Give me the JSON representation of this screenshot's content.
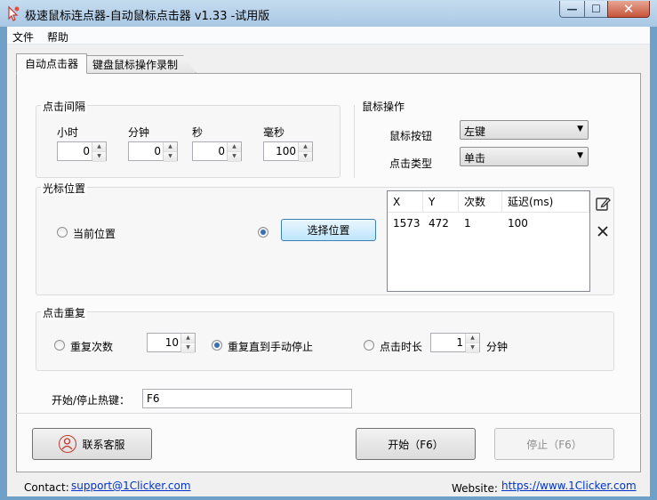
{
  "window": {
    "title": "极速鼠标连点器-自动鼠标点击器 v1.33  -试用版",
    "min": "—",
    "max": "☐",
    "close": "✕"
  },
  "menu": [
    "文件",
    "帮助"
  ],
  "tabs": [
    "自动点击器",
    "键盘鼠标操作录制"
  ],
  "interval": {
    "group_label": "点击间隔",
    "hours": {
      "label": "小时",
      "value": "0"
    },
    "minutes": {
      "label": "分钟",
      "value": "0"
    },
    "seconds": {
      "label": "秒",
      "value": "0"
    },
    "ms": {
      "label": "毫秒",
      "value": "100"
    }
  },
  "mouse": {
    "group_label": "鼠标操作",
    "button_label": "鼠标按钮",
    "button_value": "左键",
    "click_type_label": "点击类型",
    "click_type_value": "单击"
  },
  "cursor": {
    "group_label": "光标位置",
    "current_position_label": "当前位置",
    "current_position_selected": false,
    "pick_position_selected": true,
    "pick_button": "选择位置",
    "table_headers": [
      "X",
      "Y",
      "次数",
      "延迟(ms)"
    ],
    "rows": [
      {
        "x": "1573",
        "y": "472",
        "count": "1",
        "delay": "100"
      }
    ]
  },
  "repeat": {
    "group_label": "点击重复",
    "repeat_count_label": "重复次数",
    "repeat_count_value": "10",
    "until_stop_label": "重复直到手动停止",
    "duration_label": "点击时长",
    "duration_value": "1",
    "duration_unit": "分钟",
    "selected": "until_stop"
  },
  "hotkey": {
    "label": "开始/停止热键：",
    "value": "F6"
  },
  "buttons": {
    "contact": "联系客服",
    "start": "开始（F6）",
    "stop": "停止（F6）"
  },
  "footer": {
    "contact_label": "Contact:",
    "contact_email": "support@1Clicker.com",
    "website_label": "Website:",
    "website_url": "https://www.1Clicker.com"
  },
  "colors": {
    "titlebar": "#a9c7e4",
    "window_border": "#6fa0c8",
    "link": "#0033cc",
    "radio_dot": "#3a6fb5"
  }
}
